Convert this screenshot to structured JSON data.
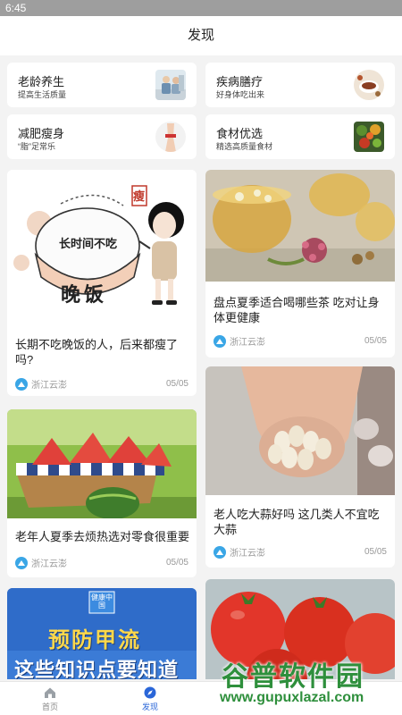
{
  "status": {
    "time": "6:45"
  },
  "header": {
    "title": "发现"
  },
  "categories": [
    {
      "title": "老龄养生",
      "subtitle": "提高生活质量"
    },
    {
      "title": "疾病膳疗",
      "subtitle": "好身体吃出来"
    },
    {
      "title": "减肥瘦身",
      "subtitle": "“脂”足常乐"
    },
    {
      "title": "食材优选",
      "subtitle": "精选高质量食材"
    }
  ],
  "articles": [
    {
      "title": "长期不吃晚饭的人，后来都瘦了吗?",
      "source": "浙江云澎",
      "date": "05/05",
      "image_text": {
        "main": "长时间不吃",
        "bowl": "晚饭",
        "tag": "瘦"
      }
    },
    {
      "title": "盘点夏季适合喝哪些茶 吃对让身体更健康",
      "source": "浙江云澎",
      "date": "05/05"
    },
    {
      "title": "老年人夏季去烦热选对零食很重要",
      "source": "浙江云澎",
      "date": "05/05"
    },
    {
      "title": "老人吃大蒜好吗 这几类人不宜吃大蒜",
      "source": "浙江云澎",
      "date": "05/05"
    },
    {
      "image_text": {
        "badge": "健康中国",
        "line1": "预防甲流",
        "line2": "这些知识点要知道"
      }
    },
    {
      "image_text": {}
    }
  ],
  "tabbar": [
    {
      "label": "首页",
      "active": false
    },
    {
      "label": "发现",
      "active": true
    }
  ],
  "watermark": {
    "cn": "谷普软件园",
    "url": "www.gupuxlazal.com"
  },
  "colors": {
    "accent": "#2a66d8",
    "source_icon": "#3aa6e6",
    "watermark": "#2e8f3c"
  }
}
